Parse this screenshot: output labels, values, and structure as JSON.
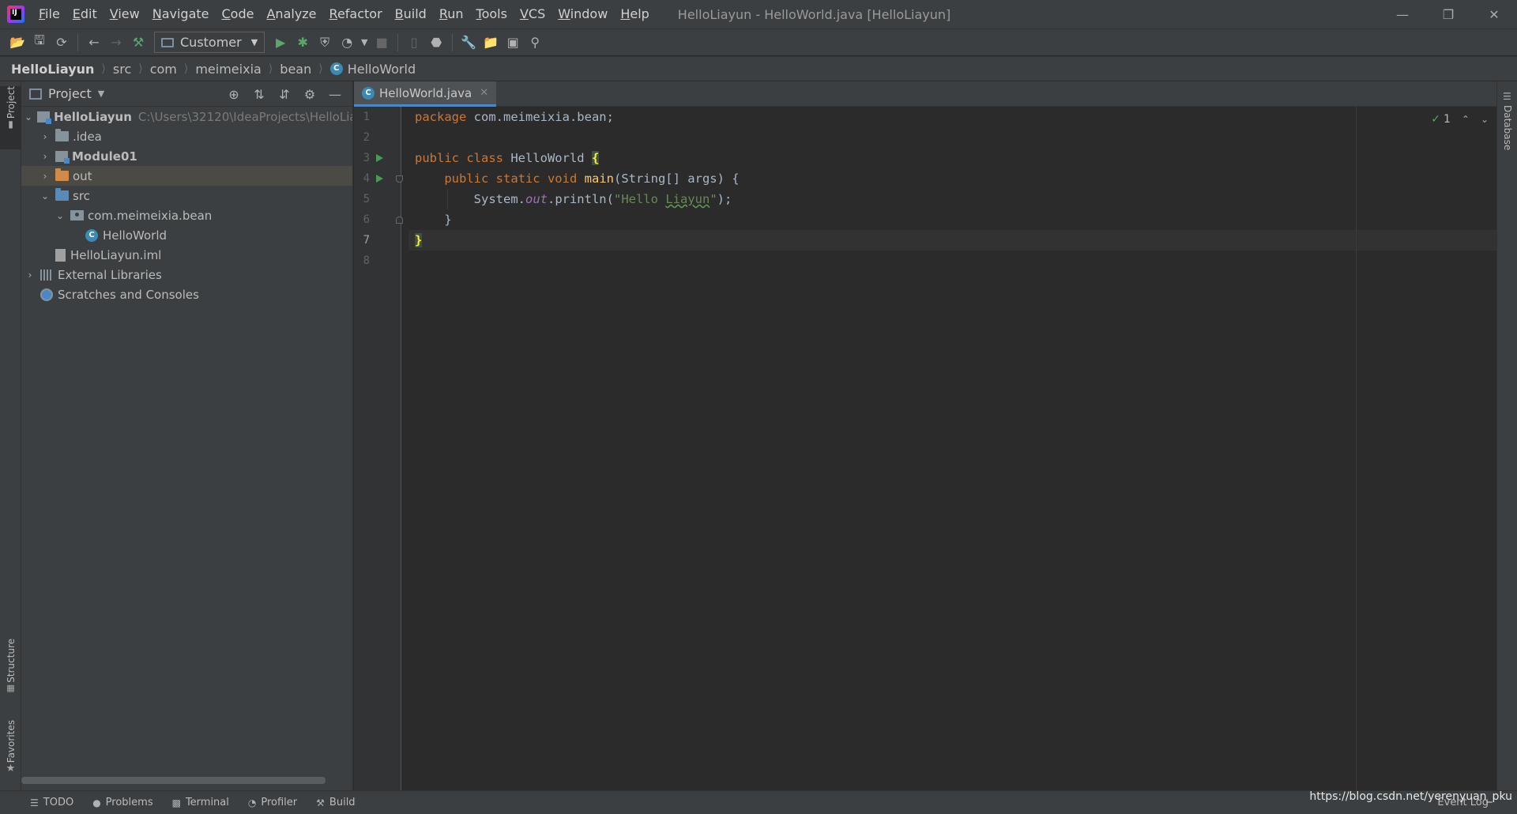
{
  "window": {
    "title": "HelloLiayun - HelloWorld.java [HelloLiayun]",
    "minimize_icon": "minimize-icon",
    "restore_icon": "restore-icon",
    "close_icon": "close-icon"
  },
  "menu": [
    "File",
    "Edit",
    "View",
    "Navigate",
    "Code",
    "Analyze",
    "Refactor",
    "Build",
    "Run",
    "Tools",
    "VCS",
    "Window",
    "Help"
  ],
  "toolbar": {
    "run_config": "Customer"
  },
  "breadcrumb": [
    "HelloLiayun",
    "src",
    "com",
    "meimeixia",
    "bean",
    "HelloWorld"
  ],
  "left_stripe": {
    "project": "Project",
    "structure": "Structure",
    "favorites": "Favorites"
  },
  "right_stripe": {
    "database": "Database"
  },
  "project_panel": {
    "title": "Project",
    "tree": [
      {
        "label": "HelloLiayun",
        "extra": "C:\\Users\\32120\\IdeaProjects\\HelloLiayun"
      },
      {
        "label": ".idea"
      },
      {
        "label": "Module01"
      },
      {
        "label": "out"
      },
      {
        "label": "src"
      },
      {
        "label": "com.meimeixia.bean"
      },
      {
        "label": "HelloWorld"
      },
      {
        "label": "HelloLiayun.iml"
      },
      {
        "label": "External Libraries"
      },
      {
        "label": "Scratches and Consoles"
      }
    ]
  },
  "editor": {
    "tab": "HelloWorld.java",
    "line_numbers": [
      "1",
      "2",
      "3",
      "4",
      "5",
      "6",
      "7",
      "8"
    ],
    "code": {
      "l1_kw": "package",
      "l1_rest": " com.meimeixia.bean;",
      "l3_kw": "public class",
      "l3_name": " HelloWorld ",
      "l3_brace": "{",
      "l4_indent": "    ",
      "l4_kw": "public static void",
      "l4_fn": "main",
      "l4_rest": "(String[] args) {",
      "l5_a": "        System.",
      "l5_field": "out",
      "l5_b": ".println(",
      "l5_str_a": "\"Hello ",
      "l5_str_typo": "Liayun",
      "l5_str_b": "\"",
      "l5_c": ");",
      "l6": "    }",
      "l7_brace": "}"
    },
    "inspection_count": "1"
  },
  "statusbar": {
    "items": [
      "TODO",
      "Problems",
      "Terminal",
      "Profiler",
      "Build"
    ],
    "event_log": "Event Log",
    "watermark": "https://blog.csdn.net/yerenyuan_pku"
  },
  "colors": {
    "keyword": "#cc7832",
    "function": "#ffc66d",
    "string": "#6a8759",
    "field": "#9876aa",
    "text": "#a9b7c6",
    "background": "#2b2b2b",
    "panel": "#3c3f41"
  }
}
